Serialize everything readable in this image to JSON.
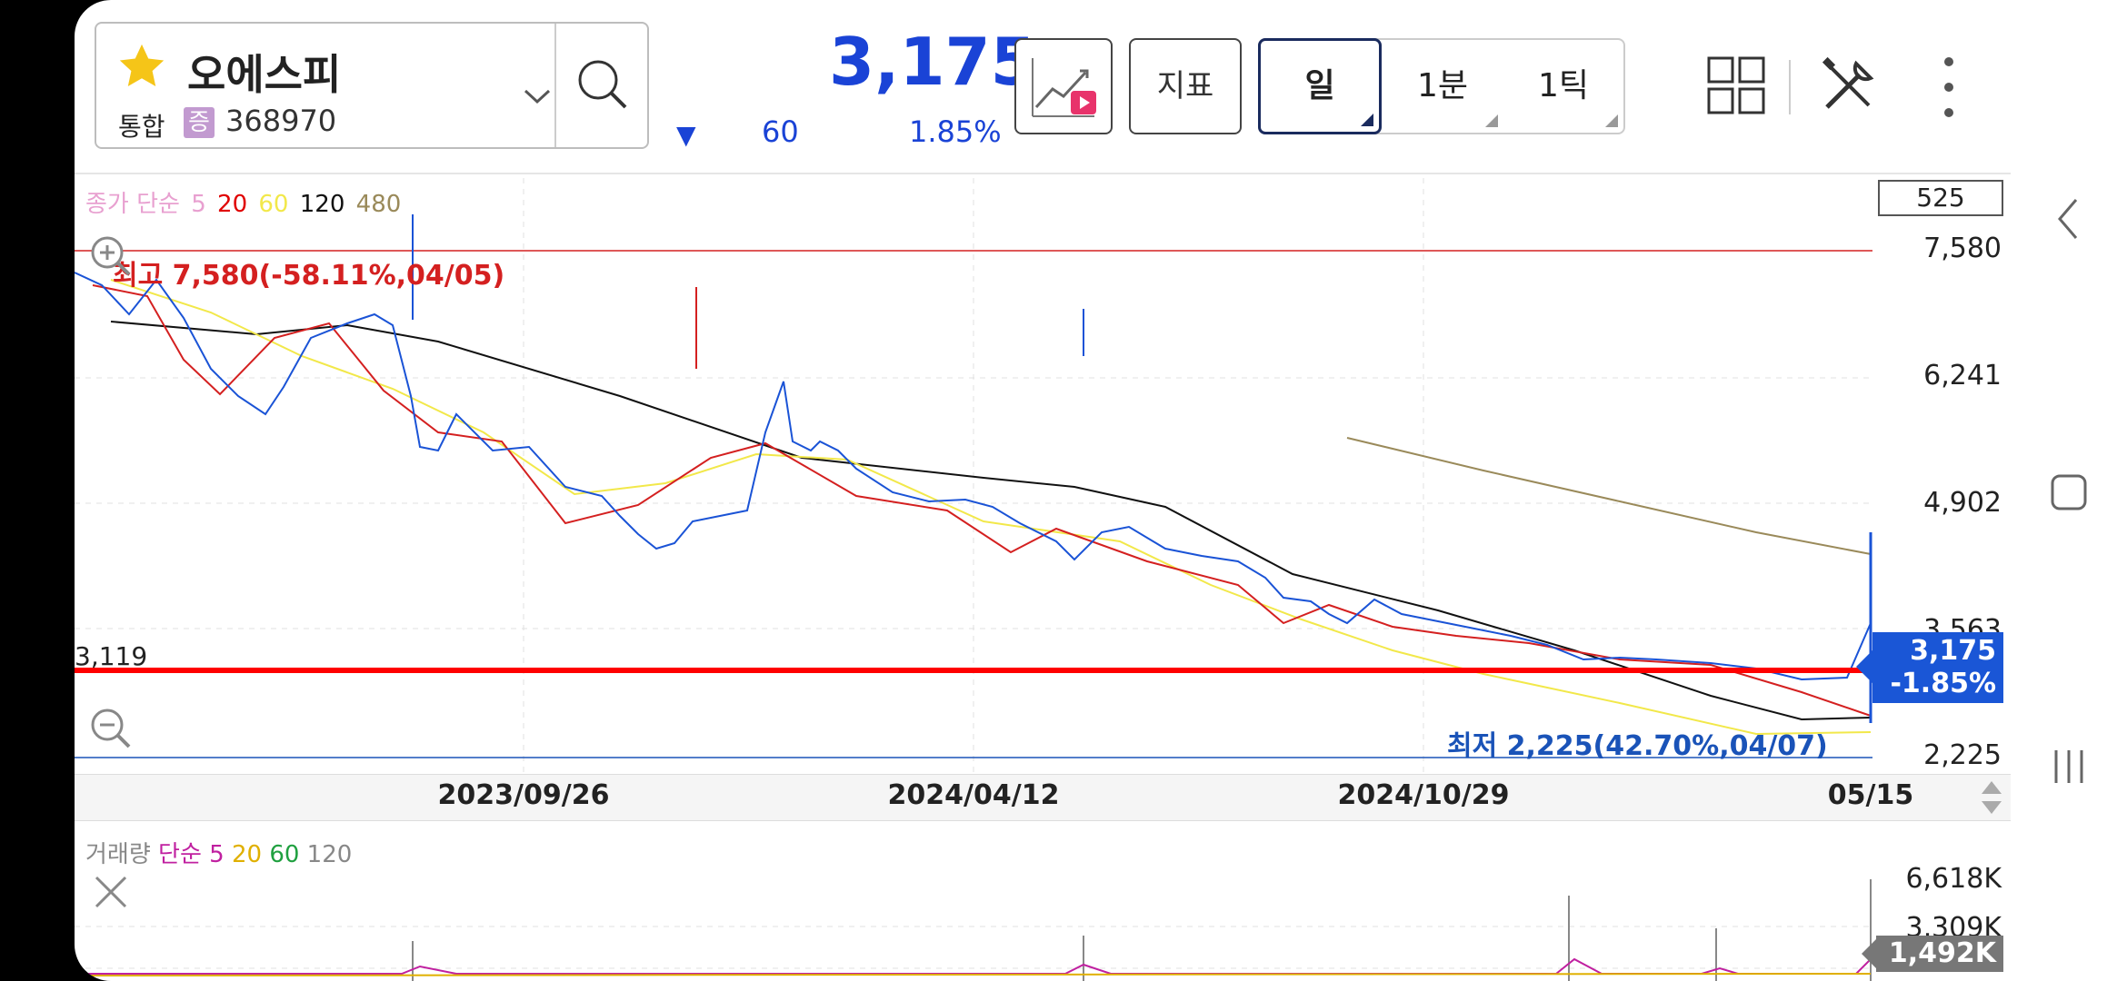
{
  "stock": {
    "name": "오에스피",
    "market_type": "통합",
    "market_badge": "증",
    "code": "368970"
  },
  "quote": {
    "price": "3,175",
    "change": "60",
    "change_pct": "1.85%",
    "direction": "down",
    "color": "#1a43d6"
  },
  "toolbar": {
    "indicator_label": "지표",
    "periods": [
      {
        "label": "일",
        "active": true
      },
      {
        "label": "1분",
        "active": false
      },
      {
        "label": "1틱",
        "active": false
      }
    ]
  },
  "price_chart": {
    "legend": {
      "prefix": "종가 단순",
      "periods": [
        {
          "label": "5",
          "color": "#e8a0d0"
        },
        {
          "label": "20",
          "color": "#e00000"
        },
        {
          "label": "60",
          "color": "#f2e84a"
        },
        {
          "label": "120",
          "color": "#111111"
        },
        {
          "label": "480",
          "color": "#9a8a5a"
        }
      ]
    },
    "visible_count": "525",
    "y_labels": [
      "7,580",
      "6,241",
      "4,902",
      "3,563",
      "2,225"
    ],
    "x_labels": [
      "2023/09/26",
      "2024/04/12",
      "2024/10/29",
      "05/15"
    ],
    "high_annotation": "최고 7,580(-58.11%,04/05)",
    "low_annotation": "최저 2,225(42.70%,04/07)",
    "line_value": "3,119",
    "current_tag": {
      "price": "3,175",
      "change": "-1.85%"
    }
  },
  "volume_chart": {
    "legend": {
      "prefix": "거래량",
      "method": "단순",
      "periods": [
        {
          "label": "5",
          "color": "#c020a0"
        },
        {
          "label": "20",
          "color": "#e0b000"
        },
        {
          "label": "60",
          "color": "#20a040"
        },
        {
          "label": "120",
          "color": "#888888"
        }
      ]
    },
    "y_labels": [
      "6,618K",
      "3,309K"
    ],
    "current_tag": "1,492K"
  },
  "chart_data": {
    "type": "line",
    "title": "",
    "ylim": [
      2225,
      7580
    ],
    "x": [
      "2023/04/05",
      "2023/09/26",
      "2024/04/12",
      "2024/10/29",
      "2025/05/15"
    ],
    "series": [
      {
        "name": "",
        "values": [
          7580,
          5600,
          4900,
          3550,
          3175
        ]
      }
    ]
  }
}
